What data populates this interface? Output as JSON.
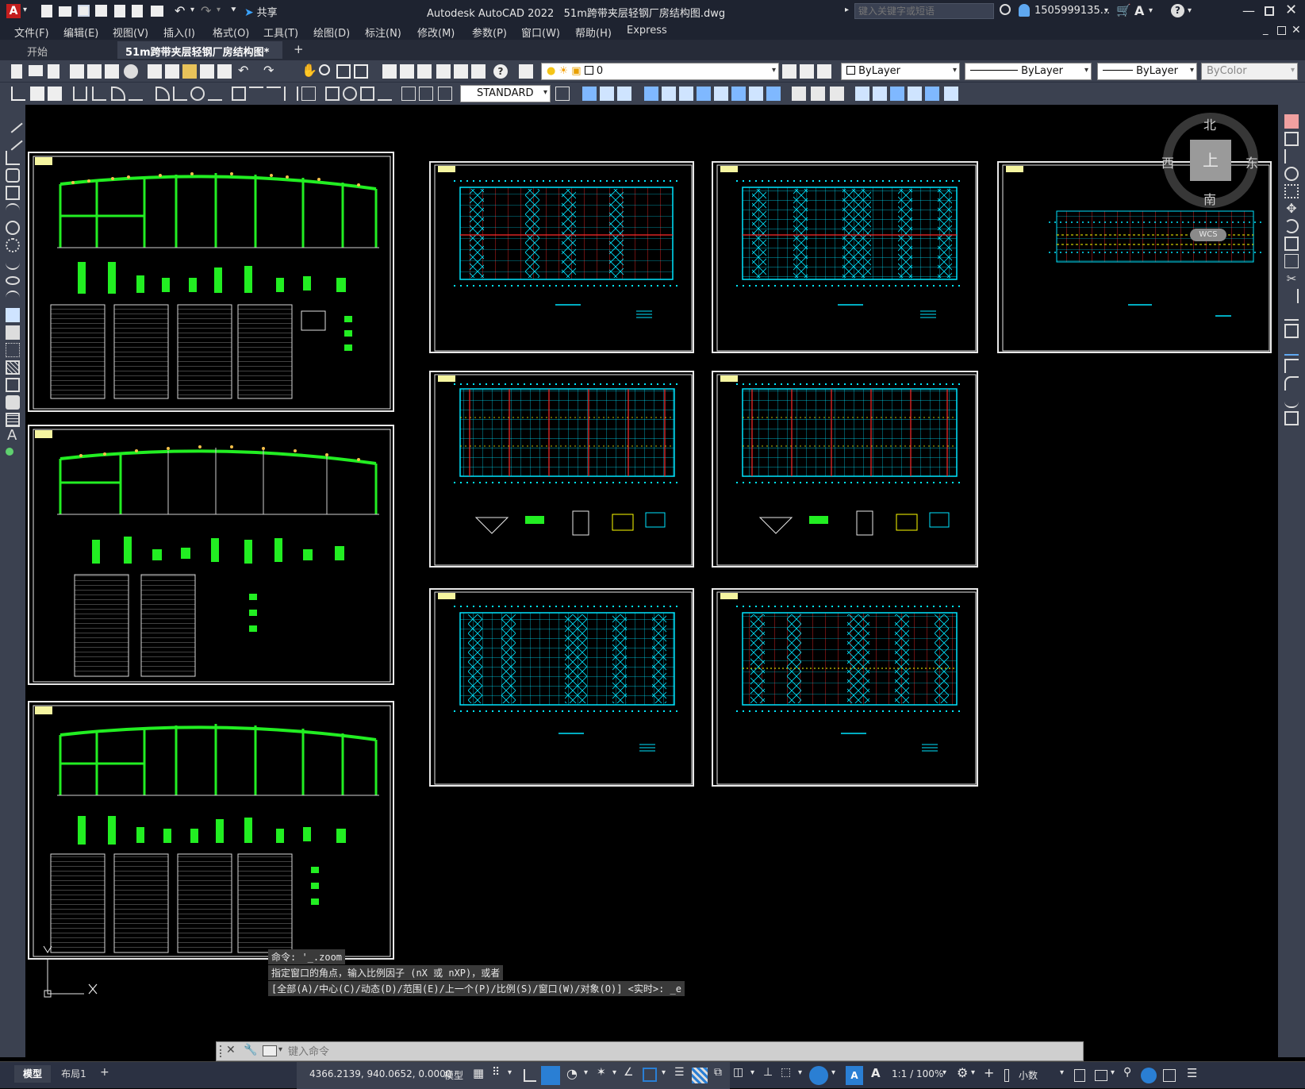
{
  "app": {
    "title": "Autodesk AutoCAD 2022",
    "document": "51m跨带夹层轻钢厂房结构图.dwg",
    "search_placeholder": "键入关键字或短语",
    "user": "1505999135...",
    "share_label": "共享"
  },
  "menu": {
    "items": [
      "文件(F)",
      "编辑(E)",
      "视图(V)",
      "插入(I)",
      "格式(O)",
      "工具(T)",
      "绘图(D)",
      "标注(N)",
      "修改(M)",
      "参数(P)",
      "窗口(W)",
      "帮助(H)",
      "Express"
    ]
  },
  "tabs": {
    "start": "开始",
    "active": "51m跨带夹层轻钢厂房结构图*",
    "add": "+"
  },
  "props": {
    "layer": "0",
    "color": "ByLayer",
    "linetype": "ByLayer",
    "lineweight": "ByLayer",
    "plotstyle": "ByColor",
    "textstyle": "STANDARD"
  },
  "viewcube": {
    "north": "北",
    "south": "南",
    "east": "东",
    "west": "西",
    "face": "上",
    "wcs": "WCS"
  },
  "command": {
    "history": [
      "命令: '_.zoom",
      "指定窗口的角点，输入比例因子 (nX 或 nXP)，或者",
      "[全部(A)/中心(C)/动态(D)/范围(E)/上一个(P)/比例(S)/窗口(W)/对象(O)] <实时>: _e"
    ],
    "placeholder": "键入命令"
  },
  "status": {
    "model_tab": "模型",
    "layout_tab": "布局1",
    "coords": "4366.2139, 940.0652, 0.0000",
    "model_label": "模型",
    "scale": "1:1 / 100%",
    "units": "小数"
  },
  "colors": {
    "accent": "#2a7fd4",
    "cyan": "#00ffff",
    "red": "#ff2020",
    "green": "#22ee22",
    "yellow": "#ffff00"
  }
}
